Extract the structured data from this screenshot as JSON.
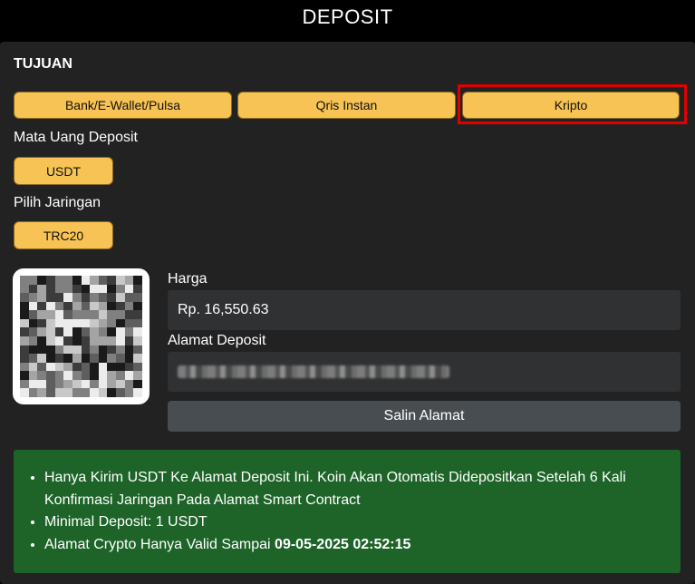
{
  "header": {
    "title": "DEPOSIT"
  },
  "section": {
    "title": "TUJUAN"
  },
  "methods": [
    {
      "label": "Bank/E-Wallet/Pulsa"
    },
    {
      "label": "Qris Instan"
    },
    {
      "label": "Kripto",
      "selected": true
    }
  ],
  "currency": {
    "label": "Mata Uang Deposit",
    "value": "USDT"
  },
  "network": {
    "label": "Pilih Jaringan",
    "value": "TRC20"
  },
  "price": {
    "label": "Harga",
    "value": "Rp. 16,550.63"
  },
  "address": {
    "label": "Alamat Deposit"
  },
  "copy_button": {
    "label": "Salin Alamat"
  },
  "notes": {
    "line1": "Hanya Kirim USDT Ke Alamat Deposit Ini. Koin Akan Otomatis Didepositkan Setelah 6 Kali Konfirmasi Jaringan Pada Alamat Smart Contract",
    "line2": "Minimal Deposit: 1 USDT",
    "line3_prefix": "Alamat Crypto Hanya Valid Sampai ",
    "line3_datetime": "09-05-2025 02:52:15"
  },
  "colors": {
    "accent": "#f6c354",
    "highlight": "#e00000",
    "info_bg": "#1e6429",
    "panel_bg": "#222222"
  },
  "icons": {
    "qr": "qr-code-image"
  }
}
